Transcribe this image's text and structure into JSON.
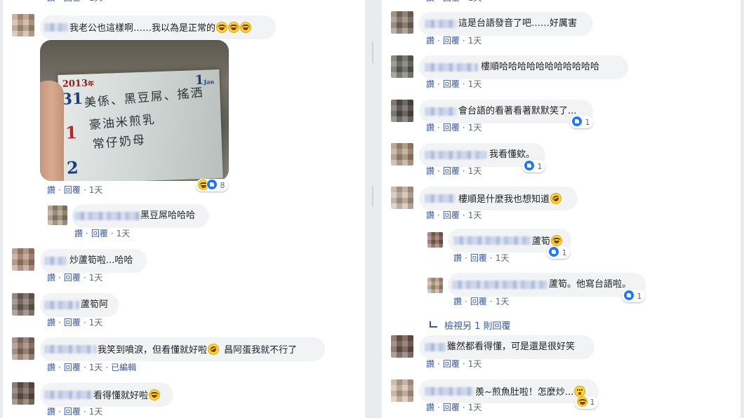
{
  "actions": {
    "like": "讚",
    "reply": "回覆",
    "time": "1天",
    "edited": "已編輯",
    "dot": "·"
  },
  "left": [
    {
      "text": "我老公也這樣啊……我以為是正常的"
    },
    {
      "reactions_count": "8"
    },
    {
      "text": "黑豆屌哈哈哈"
    },
    {
      "text": "炒蘆筍啦...哈哈"
    },
    {
      "text": "蘆筍阿"
    },
    {
      "text": "我笑到噴淚，但看懂就好啦",
      "text2": "昌阿蛋我就不行了"
    },
    {
      "text": "看得懂就好啦"
    }
  ],
  "right": [
    {
      "text": "這是台語發音了吧……好厲害"
    },
    {
      "text": "樓順哈哈哈哈哈哈哈哈哈哈哈"
    },
    {
      "text": "會台語的看著看著默默笑了...",
      "reactions_count": "1"
    },
    {
      "text": "我看懂欸。",
      "reactions_count": "1"
    },
    {
      "text": "樓順是什麼我也想知道"
    },
    {
      "text": "蘆筍",
      "reactions_count": "1"
    },
    {
      "text": "蘆筍。他寫台語啦。",
      "reactions_count": "1"
    },
    {
      "text": "雖然都看得懂，可是還是很好笑"
    },
    {
      "text": "羨~煎魚肚啦！怎麼炒...",
      "reactions_count": "1"
    }
  ],
  "view_more": "檢視另 1 則回覆",
  "photo": {
    "year": "2013",
    "year_suffix": "年",
    "month": "1",
    "month_en": "Jan",
    "num_31": "31",
    "num_1": "1",
    "num_2": "2",
    "line1": "美係、黑豆屌、搖洒",
    "line2": "豪油米煎乳",
    "line3": "常仔奶母"
  }
}
